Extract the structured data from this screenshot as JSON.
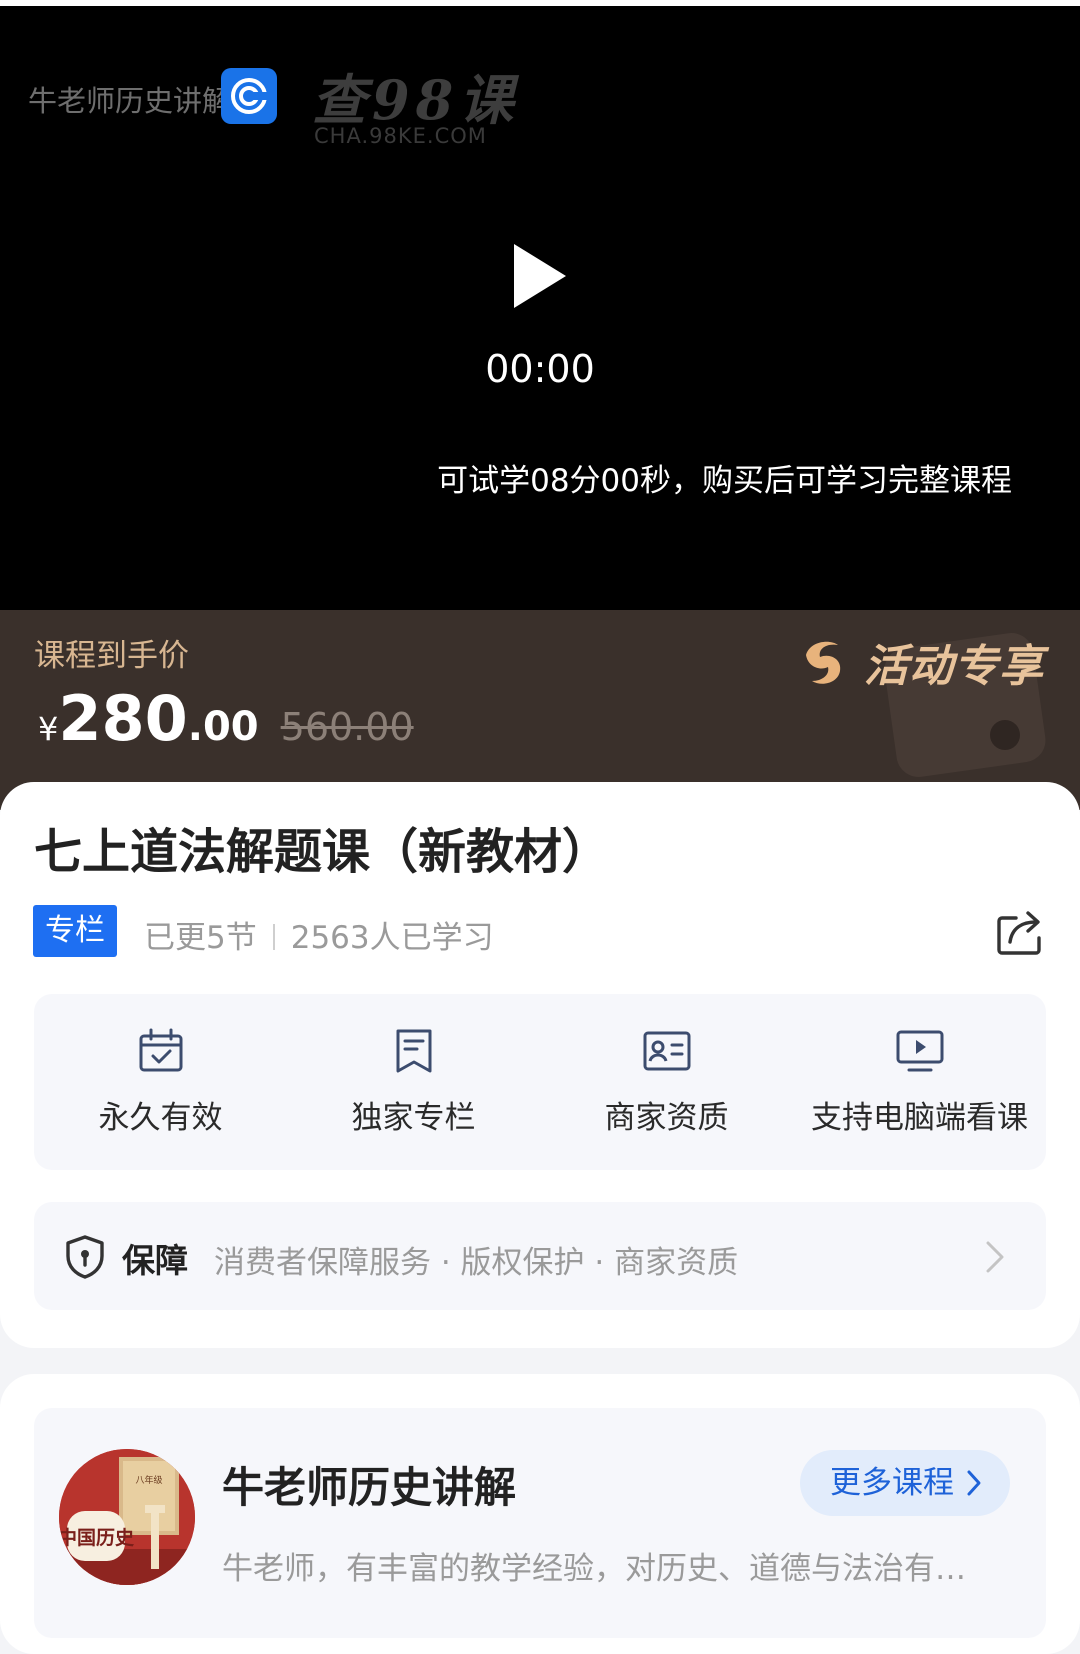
{
  "player": {
    "channel_name": "牛老师历史讲解",
    "watermark_cn": "查98课",
    "watermark_en": "CHA.98KE.COM",
    "time": "00:00",
    "trial_note": "可试学08分00秒，购买后可学习完整课程"
  },
  "price": {
    "label": "课程到手价",
    "currency": "¥",
    "integer": "280",
    "decimal": ".00",
    "original": "560.00",
    "promo": "活动专享"
  },
  "course": {
    "title": "七上道法解题课（新教材）",
    "tag": "专栏",
    "updated": "已更5节",
    "learners": "2563人已学习"
  },
  "features": [
    {
      "label": "永久有效",
      "icon": "calendar-check-icon"
    },
    {
      "label": "独家专栏",
      "icon": "bookmark-doc-icon"
    },
    {
      "label": "商家资质",
      "icon": "id-card-icon"
    },
    {
      "label": "支持电脑端看课",
      "icon": "monitor-play-icon"
    }
  ],
  "guarantee": {
    "title": "保障",
    "items": "消费者保障服务 · 版权保护 · 商家资质"
  },
  "author": {
    "name": "牛老师历史讲解",
    "description": "牛老师，有丰富的教学经验，对历史、道德与法治有…",
    "more_button": "更多课程",
    "avatar_text": "中国历史",
    "avatar_grade": "八年级"
  },
  "colors": {
    "accent_blue": "#1e6ff2",
    "price_banner": "#3a302b",
    "promo_gold": "#e8c39b"
  }
}
